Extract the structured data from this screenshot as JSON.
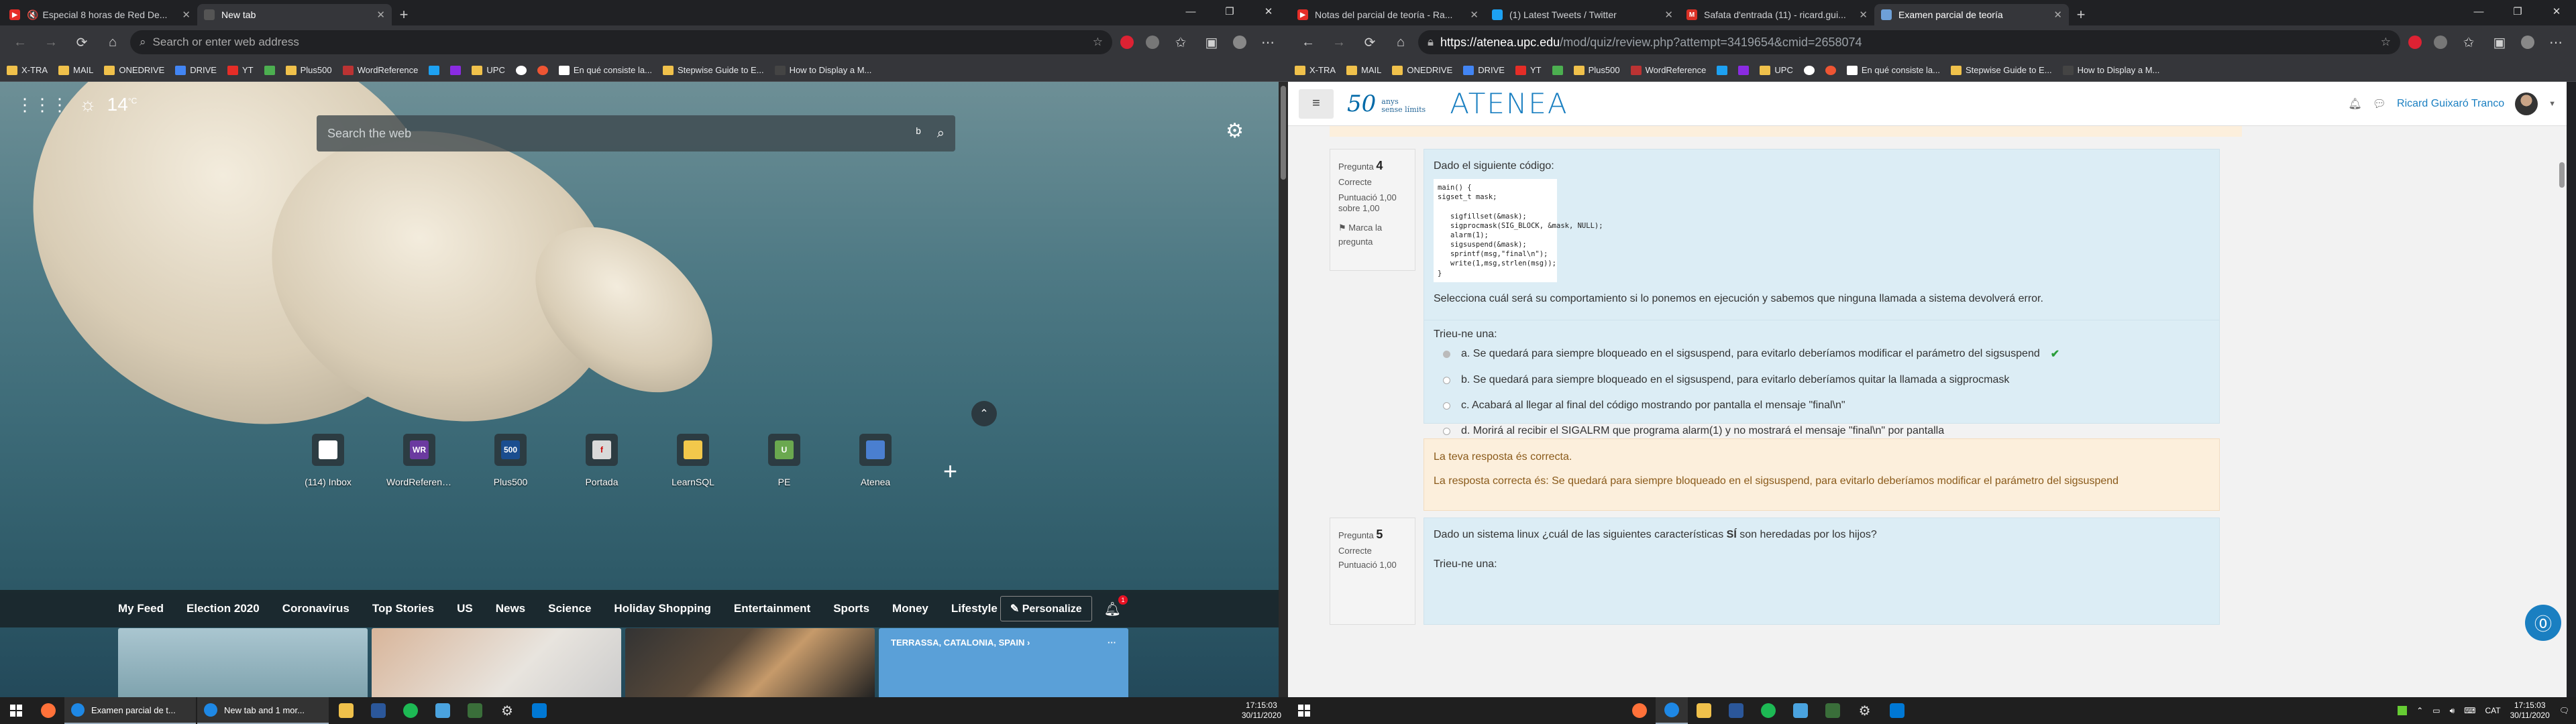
{
  "left_window": {
    "tabs": [
      {
        "title": "Especial 8 horas de Red De...",
        "favicon_color": "#e52d27",
        "muted": true
      },
      {
        "title": "New tab",
        "favicon_color": "#555",
        "active": true
      }
    ],
    "new_tab_symbol": "+",
    "address_placeholder": "Search or enter web address",
    "bookmarks": [
      "X-TRA",
      "MAIL",
      "ONEDRIVE",
      "DRIVE",
      "YT",
      "",
      "Plus500",
      "WordReference",
      "",
      "",
      "UPC",
      "",
      "",
      "En qué consiste la...",
      "Stepwise Guide to E...",
      "How to Display a M..."
    ],
    "ntp": {
      "temperature": "14",
      "temperature_unit": "°C",
      "search_placeholder": "Search the web",
      "sites": [
        {
          "label": "(114) Inbox",
          "icon_text": "",
          "color": "#444"
        },
        {
          "label": "WordReferenc...",
          "icon_text": "WR",
          "color": "#6b3aa0"
        },
        {
          "label": "Plus500",
          "icon_text": "500",
          "color": "#1a4d8f"
        },
        {
          "label": "Portada",
          "icon_text": "f",
          "color": "#d9d9d9"
        },
        {
          "label": "LearnSQL",
          "icon_text": "",
          "color": "#f2c84b"
        },
        {
          "label": "PE",
          "icon_text": "U",
          "color": "#6aa84f"
        },
        {
          "label": "Atenea",
          "icon_text": "",
          "color": "#4a7fd0"
        }
      ],
      "feed_nav": [
        "My Feed",
        "Election 2020",
        "Coronavirus",
        "Top Stories",
        "US",
        "News",
        "Science",
        "Holiday Shopping",
        "Entertainment",
        "Sports",
        "Money",
        "Lifestyle"
      ],
      "personalize_label": "Personalize",
      "notif_count": "1",
      "weather_card": "TERRASSA, CATALONIA, SPAIN",
      "weather_card_chevron": "›",
      "more": "···"
    }
  },
  "right_window": {
    "tabs": [
      {
        "title": "Notas del parcial de teoría - Ra...",
        "favicon_color": "#e52d27"
      },
      {
        "title": "(1) Latest Tweets / Twitter",
        "favicon_color": "#1da1f2"
      },
      {
        "title": "Safata d'entrada (11) - ricard.gui...",
        "favicon_color": "#d93025"
      },
      {
        "title": "Examen parcial de teoría",
        "favicon_color": "#6ea0d8",
        "active": true
      }
    ],
    "new_tab_symbol": "+",
    "url_host": "https://atenea.upc.edu",
    "url_path": "/mod/quiz/review.php?attempt=3419654&cmid=2658074",
    "bookmarks": [
      "X-TRA",
      "MAIL",
      "ONEDRIVE",
      "DRIVE",
      "YT",
      "",
      "Plus500",
      "WordReference",
      "",
      "",
      "UPC",
      "",
      "",
      "En qué consiste la...",
      "Stepwise Guide to E...",
      "How to Display a M..."
    ],
    "site": {
      "logo_50": "50",
      "logo_years": "anys",
      "logo_tag": "sense límits",
      "brand": "ATENEA",
      "user_name": "Ricard Guixaró Tranco"
    },
    "q4": {
      "label": "Pregunta",
      "number": "4",
      "status": "Correcte",
      "score_line1": "Puntuació 1,00",
      "score_line2": "sobre 1,00",
      "flag_line1": "Marca la",
      "flag_line2": "pregunta",
      "intro": "Dado el siguiente código:",
      "code": [
        "main() {",
        "sigset_t mask;",
        "",
        "   sigfillset(&mask);",
        "   sigprocmask(SIG_BLOCK, &mask, NULL);",
        "   alarm(1);",
        "   sigsuspend(&mask);",
        "   sprintf(msg,\"final\\n\");",
        "   write(1,msg,strlen(msg));",
        "}"
      ],
      "question": "Selecciona cuál será su comportamiento si lo ponemos en ejecución y sabemos que ninguna llamada a sistema devolverá error.",
      "choose": "Trieu-ne una:",
      "options": [
        "a. Se quedará para siempre bloqueado en el sigsuspend, para evitarlo deberíamos modificar el parámetro del sigsuspend",
        "b. Se quedará para siempre bloqueado en el sigsuspend, para evitarlo deberíamos quitar la llamada a sigprocmask",
        "c. Acabará al llegar al final del código mostrando por pantalla el mensaje \"final\\n\"",
        "d. Morirá al recibir el SIGALRM que programa alarm(1) y no mostrará el mensaje \"final\\n\" por pantalla"
      ],
      "feedback_1": "La teva resposta és correcta.",
      "feedback_2": "La resposta correcta és: Se quedará para siempre bloqueado en el sigsuspend, para evitarlo deberíamos modificar el parámetro del sigsuspend"
    },
    "q5": {
      "label": "Pregunta",
      "number": "5",
      "status": "Correcte",
      "score_line1": "Puntuació 1,00",
      "question_pre": "Dado un sistema linux ¿cuál de las siguientes características ",
      "question_bold": "SÍ",
      "question_post": " son heredadas por los hijos?",
      "choose": "Trieu-ne una:"
    }
  },
  "taskbar_left": {
    "tasks": [
      "Examen parcial de t...",
      "New tab and 1 mor..."
    ],
    "time": "17:15:03",
    "date": "30/11/2020"
  },
  "taskbar_right": {
    "lang": "CAT",
    "time": "17:15:03",
    "date": "30/11/2020"
  }
}
